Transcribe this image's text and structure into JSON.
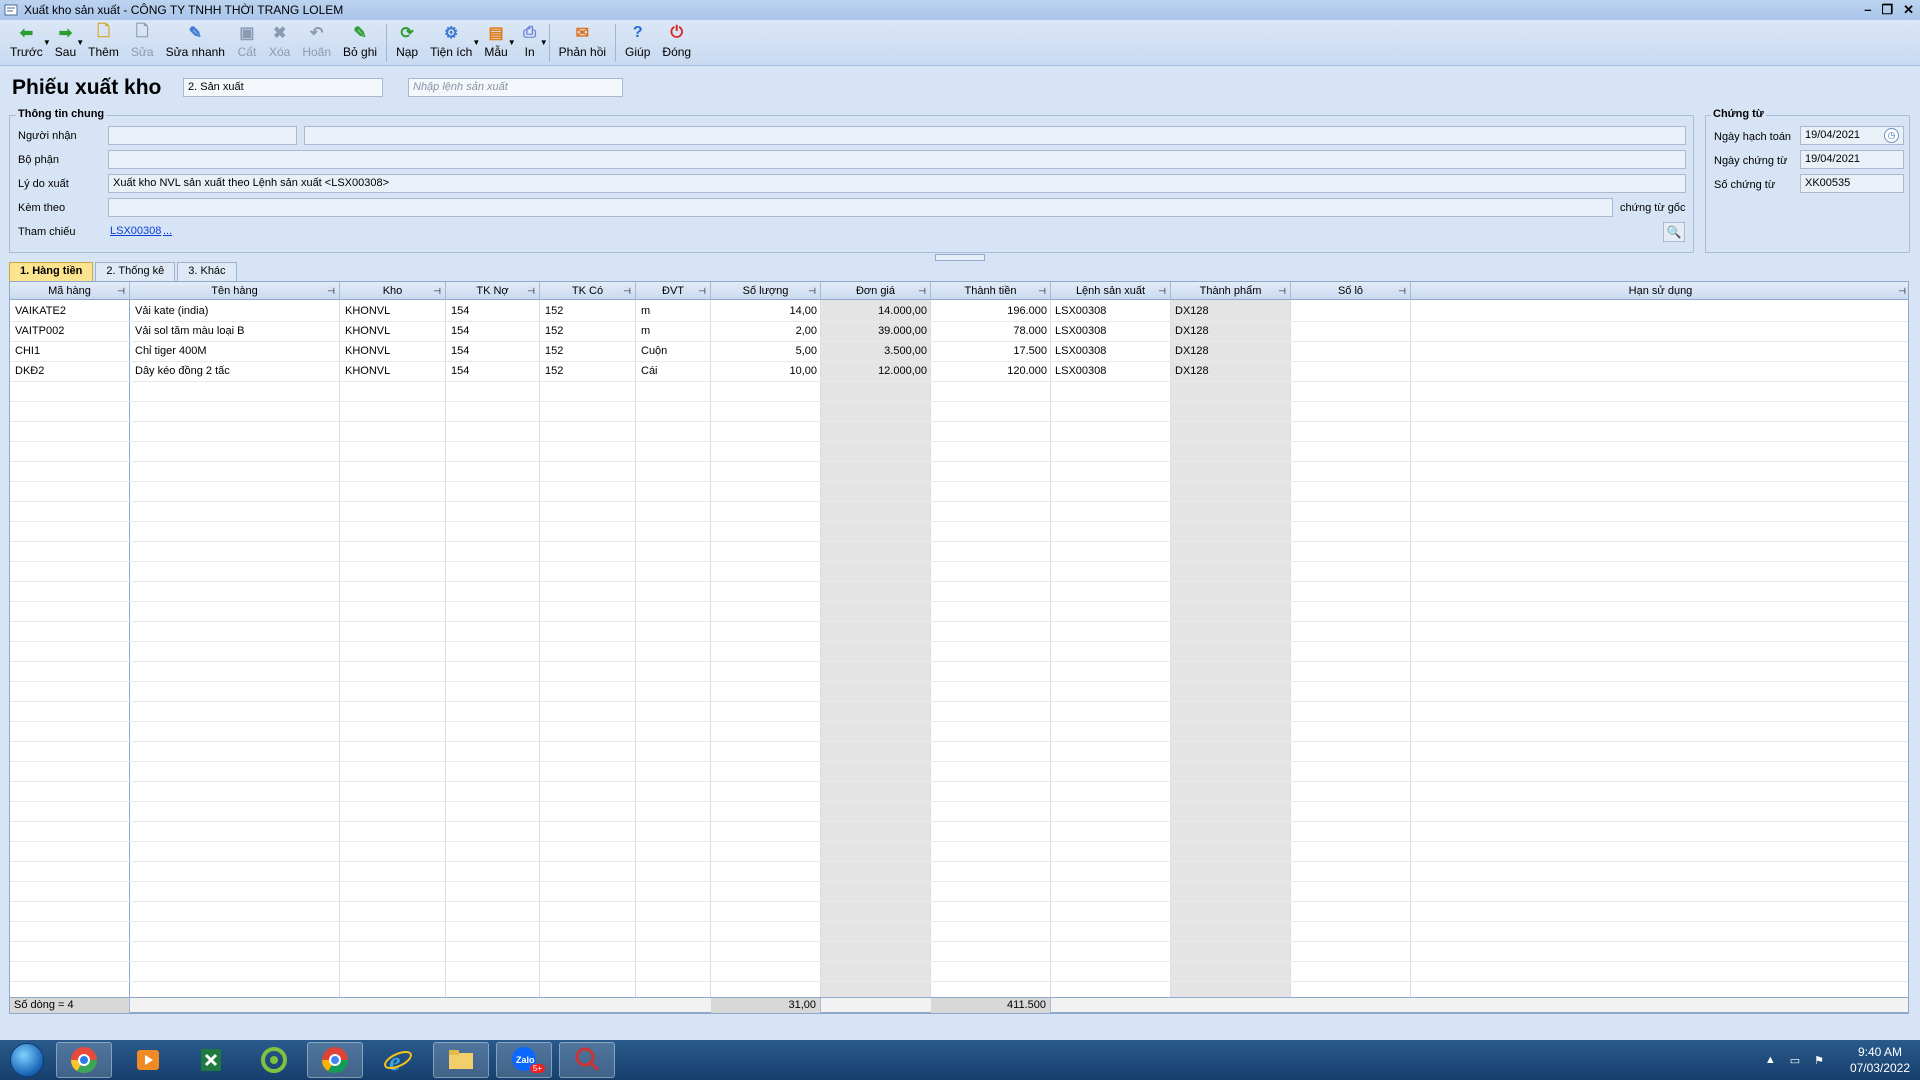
{
  "window": {
    "title": "Xuất kho sản xuất - CÔNG TY TNHH THỜI TRANG LOLEM"
  },
  "toolbar": {
    "items": [
      {
        "label": "Trước",
        "icon": "arrow-left-icon",
        "enabled": true
      },
      {
        "label": "Sau",
        "icon": "arrow-right-icon",
        "enabled": true
      },
      {
        "label": "Thêm",
        "icon": "add-document-icon",
        "enabled": true
      },
      {
        "label": "Sửa",
        "icon": "edit-document-icon",
        "enabled": false
      },
      {
        "label": "Sửa nhanh",
        "icon": "quick-edit-icon",
        "enabled": true
      },
      {
        "label": "Cất",
        "icon": "save-icon",
        "enabled": false
      },
      {
        "label": "Xóa",
        "icon": "delete-icon",
        "enabled": false
      },
      {
        "label": "Hoãn",
        "icon": "undo-icon",
        "enabled": false
      },
      {
        "label": "Bỏ ghi",
        "icon": "unpost-icon",
        "enabled": true
      },
      {
        "label": "Nạp",
        "icon": "refresh-icon",
        "enabled": true
      },
      {
        "label": "Tiện ích",
        "icon": "utility-icon",
        "enabled": true
      },
      {
        "label": "Mẫu",
        "icon": "template-icon",
        "enabled": true
      },
      {
        "label": "In",
        "icon": "print-icon",
        "enabled": true
      },
      {
        "label": "Phản hồi",
        "icon": "feedback-mail-icon",
        "enabled": true
      },
      {
        "label": "Giúp",
        "icon": "help-icon",
        "enabled": true
      },
      {
        "label": "Đóng",
        "icon": "close-icon",
        "enabled": true
      }
    ]
  },
  "form": {
    "title": "Phiếu xuất kho",
    "type_value": "2. Sản xuất",
    "production_order_placeholder": "Nhập lệnh sản xuất"
  },
  "general": {
    "group_title": "Thông tin chung",
    "recipient_label": "Người nhận",
    "recipient_code": "",
    "recipient_name": "",
    "department_label": "Bộ phận",
    "department_value": "",
    "reason_label": "Lý do xuất",
    "reason_value": "Xuất kho NVL sản xuất theo Lệnh sản xuất <LSX00308>",
    "attached_label": "Kèm theo",
    "attached_value": "",
    "attached_suffix": "chứng từ gốc",
    "reference_label": "Tham chiếu",
    "reference_value": "LSX00308",
    "reference_more": "..."
  },
  "voucher": {
    "group_title": "Chứng từ",
    "posting_date_label": "Ngày hạch toán",
    "posting_date": "19/04/2021",
    "voucher_date_label": "Ngày chứng từ",
    "voucher_date": "19/04/2021",
    "voucher_no_label": "Số chứng từ",
    "voucher_no": "XK00535"
  },
  "tabs": [
    {
      "label": "1. Hàng tiền",
      "active": true
    },
    {
      "label": "2. Thống kê",
      "active": false
    },
    {
      "label": "3. Khác",
      "active": false
    }
  ],
  "grid": {
    "columns": [
      "Mã hàng",
      "Tên hàng",
      "Kho",
      "TK Nợ",
      "TK Có",
      "ĐVT",
      "Số lượng",
      "Đơn giá",
      "Thành tiền",
      "Lệnh sản xuất",
      "Thành phẩm",
      "Số lô",
      "Hạn sử dụng"
    ],
    "rows": [
      [
        "VAIKATE2",
        "Vải kate (india)",
        "KHONVL",
        "154",
        "152",
        "m",
        "14,00",
        "14.000,00",
        "196.000",
        "LSX00308",
        "DX128",
        "",
        ""
      ],
      [
        "VAITP002",
        "Vải sol tăm màu loại B",
        "KHONVL",
        "154",
        "152",
        "m",
        "2,00",
        "39.000,00",
        "78.000",
        "LSX00308",
        "DX128",
        "",
        ""
      ],
      [
        "CHI1",
        "Chỉ tiger 400M",
        "KHONVL",
        "154",
        "152",
        "Cuộn",
        "5,00",
        "3.500,00",
        "17.500",
        "LSX00308",
        "DX128",
        "",
        ""
      ],
      [
        "DKĐ2",
        "Dây kéo đồng 2 tấc",
        "KHONVL",
        "154",
        "152",
        "Cái",
        "10,00",
        "12.000,00",
        "120.000",
        "LSX00308",
        "DX128",
        "",
        ""
      ]
    ],
    "footer": {
      "row_count": "Số dòng = 4",
      "total_qty": "31,00",
      "total_amount": "411.500"
    }
  },
  "taskbar": {
    "apps": [
      "start-orb",
      "chrome-colorful-icon",
      "media-player-icon",
      "excel-icon",
      "green-app-icon",
      "chrome-icon",
      "internet-explorer-icon",
      "file-explorer-icon",
      "zalo-icon",
      "misa-icon"
    ],
    "zalo_badge": "5+",
    "time": "9:40 AM",
    "date": "07/03/2022"
  },
  "colors": {
    "accent_tab": "#fbe38f",
    "link": "#0b3fd8",
    "shaded_column": "#e4e4e4"
  }
}
